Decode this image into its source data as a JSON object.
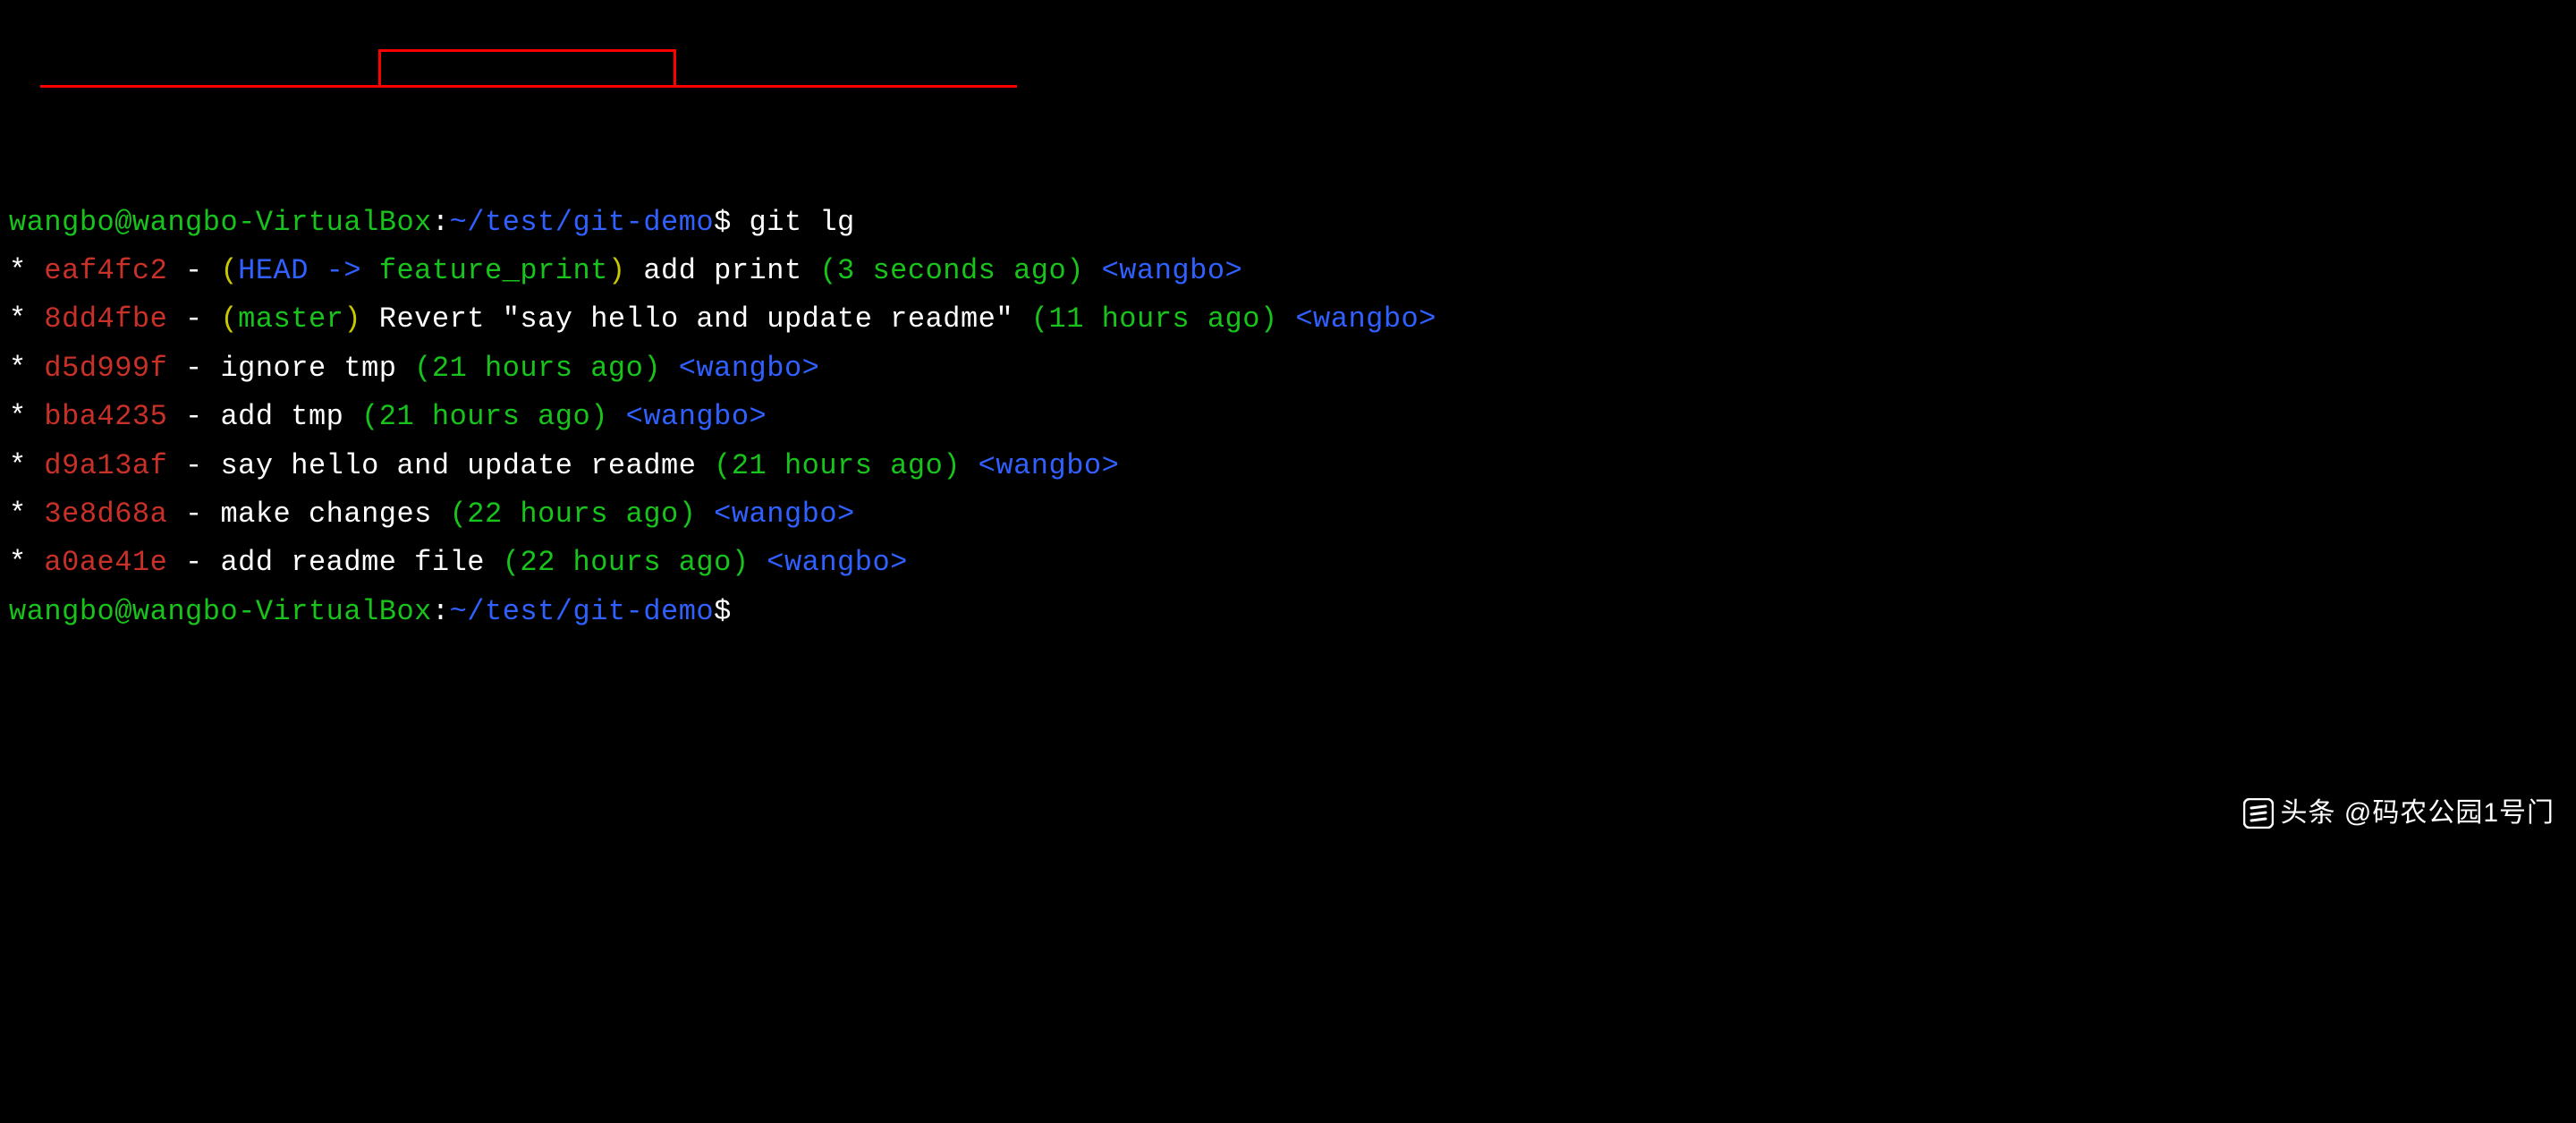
{
  "prompt1": {
    "user_host": "wangbo@wangbo-VirtualBox",
    "colon": ":",
    "path": "~/test/git-demo",
    "dollar": "$",
    "command": " git lg"
  },
  "commits": [
    {
      "graph": "* ",
      "hash": "eaf4fc2",
      "sep": " - ",
      "ref_open": "(",
      "ref_head": "HEAD -> ",
      "ref_branch": "feature_print",
      "ref_close": ")",
      "msg": " add print ",
      "time": "(3 seconds ago)",
      "author": " <wangbo>"
    },
    {
      "graph": "* ",
      "hash": "8dd4fbe",
      "sep": " - ",
      "ref_open": "(",
      "ref_branch": "master",
      "ref_close": ")",
      "msg": " Revert \"say hello and update readme\" ",
      "time": "(11 hours ago)",
      "author": " <wangbo>"
    },
    {
      "graph": "* ",
      "hash": "d5d999f",
      "sep": " - ",
      "msg": "ignore tmp ",
      "time": "(21 hours ago)",
      "author": " <wangbo>"
    },
    {
      "graph": "* ",
      "hash": "bba4235",
      "sep": " - ",
      "msg": "add tmp ",
      "time": "(21 hours ago)",
      "author": " <wangbo>"
    },
    {
      "graph": "* ",
      "hash": "d9a13af",
      "sep": " - ",
      "msg": "say hello and update readme ",
      "time": "(21 hours ago)",
      "author": " <wangbo>"
    },
    {
      "graph": "* ",
      "hash": "3e8d68a",
      "sep": " - ",
      "msg": "make changes ",
      "time": "(22 hours ago)",
      "author": " <wangbo>"
    },
    {
      "graph": "* ",
      "hash": "a0ae41e",
      "sep": " - ",
      "msg": "add readme file ",
      "time": "(22 hours ago)",
      "author": " <wangbo>"
    }
  ],
  "prompt2": {
    "user_host": "wangbo@wangbo-VirtualBox",
    "colon": ":",
    "path": "~/test/git-demo",
    "dollar": "$"
  },
  "watermark": {
    "prefix": "头条",
    "text": " @码农公园1号门"
  }
}
